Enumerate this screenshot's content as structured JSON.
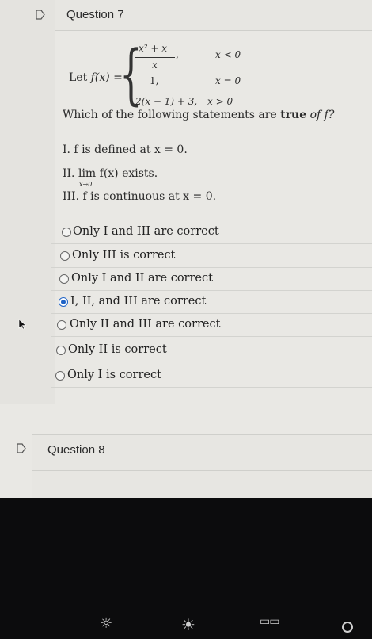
{
  "question7": {
    "title": "Question 7",
    "intro": "Let ",
    "function_lhs": "f(x) =",
    "cases": [
      {
        "expr_num": "x² + x",
        "expr_den": "x",
        "comma": ",",
        "condition": "x < 0"
      },
      {
        "expr": "1,",
        "condition": "x = 0"
      },
      {
        "expr": "2(x − 1) + 3,",
        "condition": "x > 0"
      }
    ],
    "prompt_start": "Which of the following statements are ",
    "prompt_bold": "true",
    "prompt_end": " of f?",
    "statements": [
      "I. f is defined at x = 0.",
      "II. lim f(x) exists.",
      "III. f is continuous at x = 0."
    ],
    "lim_sub": "x→0",
    "options": [
      {
        "label": "Only I and III are correct",
        "selected": false
      },
      {
        "label": "Only III is correct",
        "selected": false
      },
      {
        "label": "Only I and II are correct",
        "selected": false
      },
      {
        "label": "I, II, and III are correct",
        "selected": true
      },
      {
        "label": "Only II and III are correct",
        "selected": false
      },
      {
        "label": "Only II is correct",
        "selected": false
      },
      {
        "label": "Only I is correct",
        "selected": false
      }
    ]
  },
  "question8": {
    "title": "Question 8"
  },
  "colors": {
    "accent": "#1f63c6",
    "page": "#e9e8e4"
  },
  "keyboard_keys": [
    "brightness-down-icon",
    "brightness-up-icon",
    "mission-control-icon"
  ]
}
